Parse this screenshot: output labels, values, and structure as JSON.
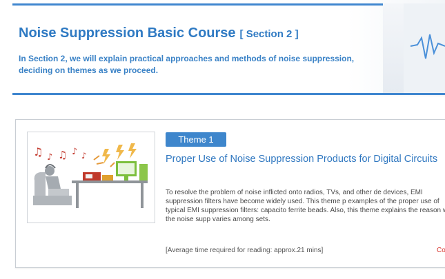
{
  "header": {
    "title": "Noise Suppression Basic Course",
    "section": "[ Section 2 ]",
    "intro": "In Section 2, we will explain practical approaches and methods of noise suppression, deciding on themes as we proceed."
  },
  "card": {
    "badge": "Theme 1",
    "title": "Proper Use of Noise Suppression Products for Digital Circuits",
    "description": "To resolve the problem of noise inflicted onto radios, TVs, and other de devices, EMI suppression filters have become widely used. This theme p examples of the proper use of typical EMI suppression filters: capacito ferrite beads. Also, this theme explains the reason why the noise supp varies among sets.",
    "reading_time": "[Average time required for reading: approx.21 mins]",
    "more_link": "Co",
    "illustration": "noise-illustration"
  },
  "colors": {
    "accent": "#3f86cf",
    "badge": "#3e86cc",
    "title_blue": "#2f77c0",
    "link_red": "#d8322c"
  }
}
